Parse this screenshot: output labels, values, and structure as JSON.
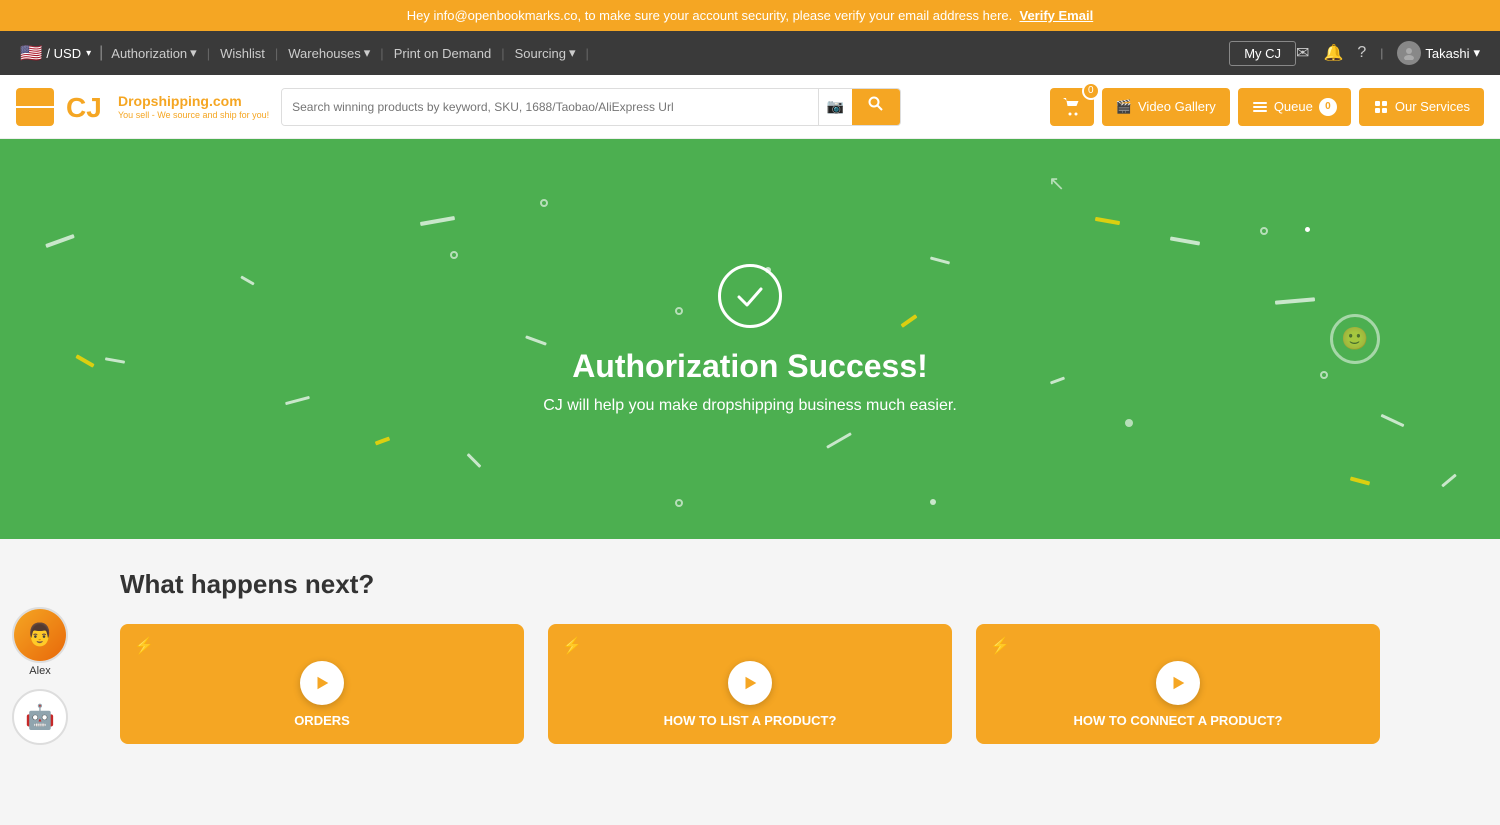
{
  "notification": {
    "text": "Hey info@openbookmarks.co, to make sure your account security, please verify your email address here.",
    "link_text": "Verify Email"
  },
  "navbar": {
    "currency": "/ USD",
    "links": [
      {
        "label": "Authorization",
        "has_dropdown": true
      },
      {
        "label": "Wishlist",
        "has_dropdown": false
      },
      {
        "label": "Warehouses",
        "has_dropdown": true
      },
      {
        "label": "Print on Demand",
        "has_dropdown": false
      },
      {
        "label": "Sourcing",
        "has_dropdown": true
      }
    ],
    "my_cj": "My CJ",
    "user": "Takashi",
    "icons": {
      "mail": "✉",
      "bell": "🔔",
      "help": "?"
    }
  },
  "header": {
    "search_placeholder": "Search winning products by keyword, SKU, 1688/Taobao/AliExpress Url",
    "logo_text": "CJ",
    "logo_subtitle": "Dropshipping.com",
    "logo_tagline": "You sell - We source and ship for you!",
    "cart_count": "0",
    "buttons": {
      "video_gallery": "Video Gallery",
      "queue": "Queue",
      "queue_count": "0",
      "our_services": "Our Services"
    }
  },
  "success": {
    "title": "Authorization Success!",
    "subtitle": "CJ will help you make dropshipping business much easier."
  },
  "next_section": {
    "title": "What happens next?",
    "cards": [
      {
        "label": "ORDERS",
        "bottom_text": ""
      },
      {
        "label": "HOW TO LIST A PRODUCT?",
        "bottom_text": ""
      },
      {
        "label": "HOW TO CONNECT A PRODUCT?",
        "bottom_text": ""
      }
    ]
  },
  "support": {
    "human_label": "Alex",
    "bot_emoji": "🤖"
  }
}
